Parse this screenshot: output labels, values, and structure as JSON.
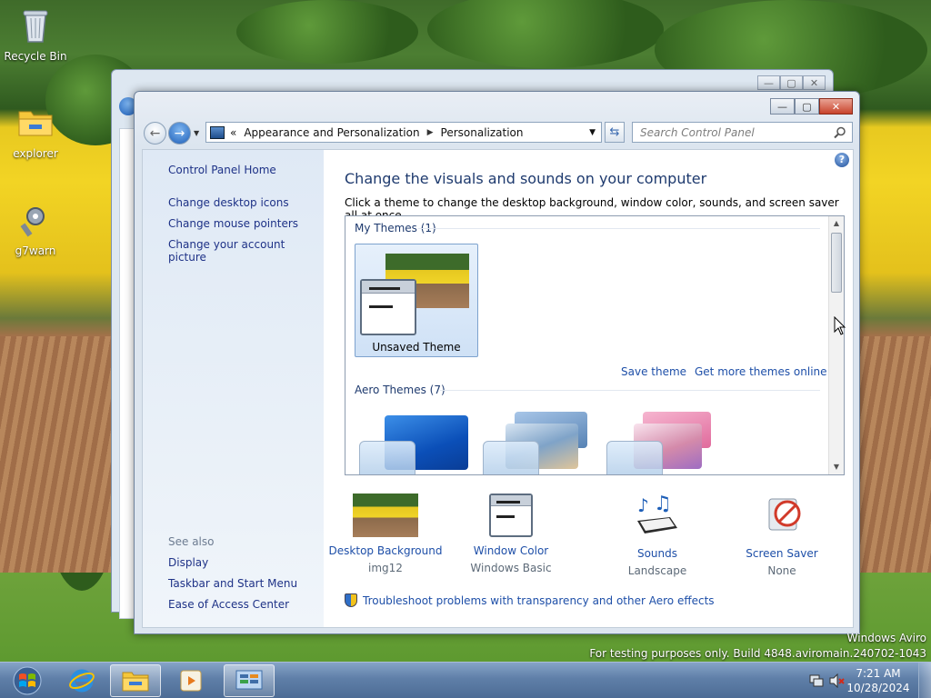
{
  "desktop": {
    "icons": [
      {
        "label": "Recycle Bin"
      },
      {
        "label": "explorer"
      },
      {
        "label": "g7warn"
      }
    ]
  },
  "window": {
    "address": {
      "back_chevrons": "«",
      "crumb1": "Appearance and Personalization",
      "crumb2": "Personalization"
    },
    "search_placeholder": "Search Control Panel",
    "caption": {
      "minimize": "—",
      "maximize": "▢",
      "close": "✕"
    }
  },
  "left_pane": {
    "home": "Control Panel Home",
    "links": [
      "Change desktop icons",
      "Change mouse pointers",
      "Change your account picture"
    ],
    "see_also_label": "See also",
    "see_also": [
      "Display",
      "Taskbar and Start Menu",
      "Ease of Access Center"
    ]
  },
  "main": {
    "heading": "Change the visuals and sounds on your computer",
    "subheading": "Click a theme to change the desktop background, window color, sounds, and screen saver all at once.",
    "my_themes_label": "My Themes (1)",
    "unsaved_theme": "Unsaved Theme",
    "save_theme": "Save theme",
    "get_more": "Get more themes online",
    "aero_themes_label": "Aero Themes (7)",
    "settings": [
      {
        "name": "Desktop Background",
        "value": "img12"
      },
      {
        "name": "Window Color",
        "value": "Windows Basic"
      },
      {
        "name": "Sounds",
        "value": "Landscape"
      },
      {
        "name": "Screen Saver",
        "value": "None"
      }
    ],
    "troubleshoot": "Troubleshoot problems with transparency and other Aero effects"
  },
  "watermark": {
    "line1": "Windows Aviro",
    "line2": "For testing purposes only. Build 4848.aviromain.240702-1043"
  },
  "taskbar": {
    "time": "7:21 AM",
    "date": "10/28/2024"
  },
  "colors": {
    "link": "#1e4fa8",
    "heading": "#1e3a6e",
    "close_button": "#c8432b",
    "taskbar": "#5f7fa8"
  }
}
